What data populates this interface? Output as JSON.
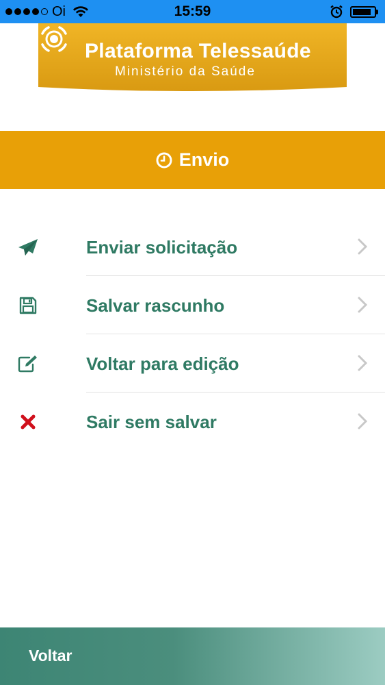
{
  "status_bar": {
    "carrier": "Oi",
    "time": "15:59",
    "signal_bars_filled": 4,
    "signal_bars_total": 5,
    "battery_level": 0.85,
    "background_color": "#1e90f2"
  },
  "banner": {
    "title": "Plataforma Telessaúde",
    "subtitle": "Ministério da Saúde",
    "logo_icon": "telessaude-logo-icon",
    "color": "#e8a007"
  },
  "section": {
    "title": "Envio",
    "icon": "clock-icon",
    "color": "#e8a007"
  },
  "menu": {
    "items": [
      {
        "label": "Enviar solicitação",
        "icon": "paper-plane-icon"
      },
      {
        "label": "Salvar rascunho",
        "icon": "floppy-disk-icon"
      },
      {
        "label": "Voltar para edição",
        "icon": "edit-icon"
      },
      {
        "label": "Sair sem salvar",
        "icon": "close-icon"
      }
    ],
    "label_color": "#2f7a63"
  },
  "footer": {
    "back_label": "Voltar"
  }
}
